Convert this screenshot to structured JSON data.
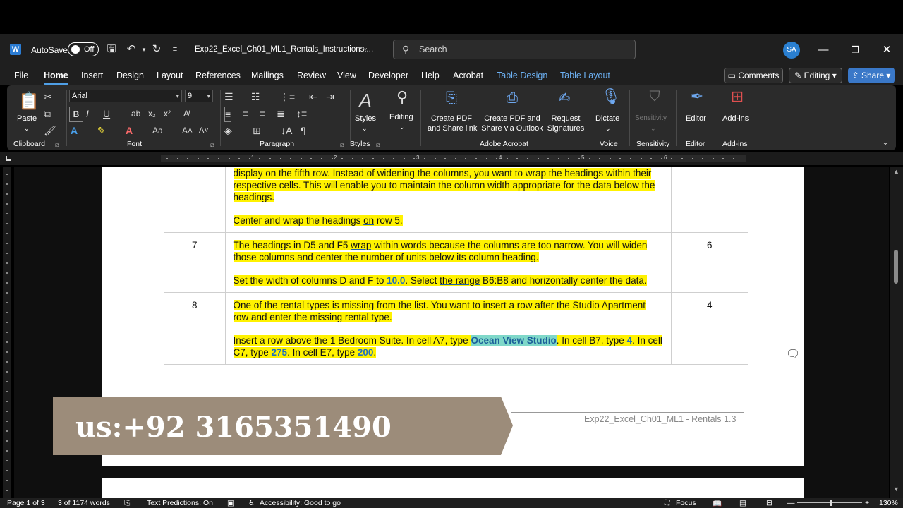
{
  "titlebar": {
    "autosave_label": "AutoSave",
    "autosave_state": "Off",
    "doc_title": "Exp22_Excel_Ch01_ML1_Rentals_Instructions....",
    "search_placeholder": "Search",
    "avatar_initials": "SA"
  },
  "menu": {
    "items": [
      "File",
      "Home",
      "Insert",
      "Design",
      "Layout",
      "References",
      "Mailings",
      "Review",
      "View",
      "Developer",
      "Help",
      "Acrobat",
      "Table Design",
      "Table Layout"
    ],
    "comments": "Comments",
    "editing": "Editing",
    "share": "Share"
  },
  "ribbon": {
    "paste": "Paste",
    "font_name": "Arial",
    "font_size": "9",
    "styles": "Styles",
    "editing": "Editing",
    "create_pdf_1": "Create PDF",
    "create_pdf_2": "and Share link",
    "create_pdf_outlook_1": "Create PDF and",
    "create_pdf_outlook_2": "Share via Outlook",
    "request_1": "Request",
    "request_2": "Signatures",
    "dictate": "Dictate",
    "sensitivity": "Sensitivity",
    "editor": "Editor",
    "addins": "Add-ins",
    "groups": {
      "clipboard": "Clipboard",
      "font": "Font",
      "paragraph": "Paragraph",
      "styles": "Styles",
      "acrobat": "Adobe Acrobat",
      "voice": "Voice",
      "sensitivity": "Sensitivity",
      "editor": "Editor",
      "addins": "Add-ins"
    }
  },
  "ruler": {
    "numbers": [
      "1",
      "2",
      "3",
      "4",
      "5",
      "6"
    ]
  },
  "document": {
    "row6": {
      "text_a": "display on the fifth row. Instead of widening the columns, you want to wrap the headings within their respective cells. This will enable you to maintain the column width appropriate for the data below the headings.",
      "text_b1": "Center and wrap the headings ",
      "text_b2": "on",
      "text_b3": " row 5."
    },
    "row7": {
      "step": "7",
      "points": "6",
      "text_a1": "The headings in D5 and F5 ",
      "text_a2": "wrap",
      "text_a3": " within words because the columns are too narrow. You will widen those columns and center the number of units below its column heading.",
      "text_b1": "Set the width of columns D and F to ",
      "text_b2": "10.0",
      "text_b3": ". Select ",
      "text_b4": "the range",
      "text_b5": " B6:B8 and horizontally center the data."
    },
    "row8": {
      "step": "8",
      "points": "4",
      "text_a": "One of the rental types is missing from the list. You want to insert a row after the Studio Apartment row and enter the missing rental type.",
      "text_b1": "Insert a row above the 1 Bedroom Suite. In cell A7, type ",
      "text_b2": "Ocean View Studio",
      "text_b3": ". In cell B7, type ",
      "text_b4": "4",
      "text_b5": ". In cell C7, type ",
      "text_b6": "275",
      "text_b7": ". In cell E7, type ",
      "text_b8": "200",
      "text_b9": "."
    },
    "footer": "Exp22_Excel_Ch01_ML1 - Rentals 1.3"
  },
  "banner": {
    "text": "us:+92 3165351490"
  },
  "status": {
    "page": "Page 1 of 3",
    "words": "3 of 1174 words",
    "predictions": "Text Predictions: On",
    "accessibility": "Accessibility: Good to go",
    "focus": "Focus",
    "zoom": "130%"
  }
}
